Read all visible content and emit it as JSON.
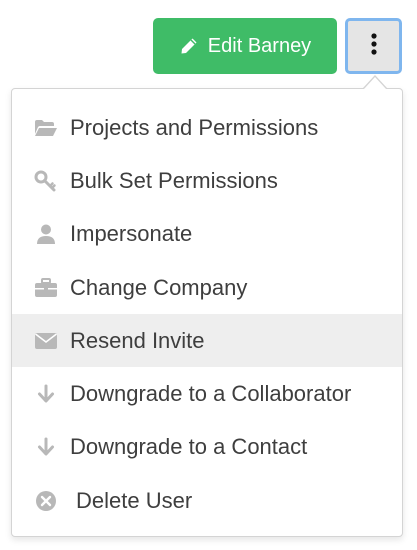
{
  "header": {
    "edit_label": "Edit Barney",
    "edit_icon": "pencil-icon",
    "more_icon": "vertical-ellipsis-icon",
    "colors": {
      "edit_bg": "#3fbc67",
      "more_bg": "#e5e5e5",
      "more_border": "#7fb6ee"
    }
  },
  "menu": {
    "items": [
      {
        "label": "Projects and Permissions",
        "icon": "folder-open-icon"
      },
      {
        "label": "Bulk Set Permissions",
        "icon": "key-icon"
      },
      {
        "label": "Impersonate",
        "icon": "user-icon"
      },
      {
        "label": "Change Company",
        "icon": "briefcase-icon"
      },
      {
        "label": "Resend Invite",
        "icon": "envelope-icon",
        "highlighted": true
      },
      {
        "label": "Downgrade to a Collaborator",
        "icon": "arrow-down-icon"
      },
      {
        "label": "Downgrade to a Contact",
        "icon": "arrow-down-icon"
      },
      {
        "label": "Delete User",
        "icon": "times-circle-icon"
      }
    ],
    "colors": {
      "text": "#3e3e3e",
      "icon": "#b8b8b8",
      "highlight": "#eeeeee"
    }
  }
}
